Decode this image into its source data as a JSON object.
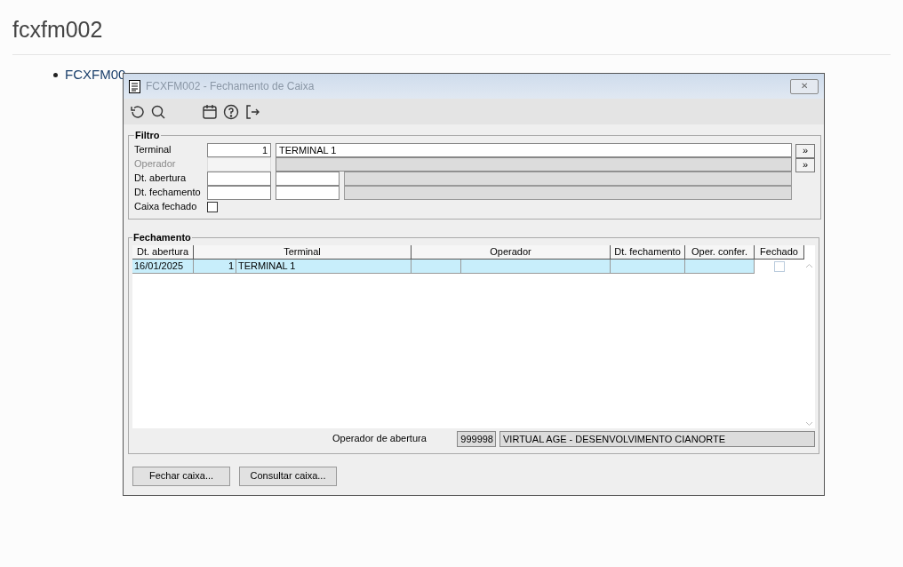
{
  "page": {
    "title": "fcxfm002",
    "list_item": "FCXFM00"
  },
  "window": {
    "title": "FCXFM002 - Fechamento de Caixa",
    "close": "✕"
  },
  "filter": {
    "legend": "Filtro",
    "rows": [
      {
        "label": "Terminal",
        "disabled": false,
        "code": "1",
        "description": "TERMINAL 1",
        "kind": "lookup",
        "button": "»"
      },
      {
        "label": "Operador",
        "disabled": true,
        "kind": "lookup",
        "button": "»"
      },
      {
        "label": "Dt. abertura",
        "disabled": false,
        "kind": "range"
      },
      {
        "label": "Dt. fechamento",
        "disabled": false,
        "kind": "range"
      },
      {
        "label": "Caixa fechado",
        "disabled": false,
        "kind": "checkbox",
        "checked": false
      }
    ]
  },
  "grid": {
    "legend": "Fechamento",
    "columns": [
      "Dt. abertura",
      "Terminal",
      "Operador",
      "Dt. fechamento",
      "Oper. confer.",
      "Fechado"
    ],
    "rows": [
      {
        "cells": [
          "16/01/2025",
          "1",
          "TERMINAL 1",
          "",
          "",
          "",
          ""
        ],
        "fechado": false,
        "selected": true
      }
    ],
    "operator_label": "Operador de abertura",
    "operator_code": "999998",
    "operator_name": "VIRTUAL AGE - DESENVOLVIMENTO CIANORTE"
  },
  "buttons": [
    "Fechar caixa...",
    "Consultar caixa..."
  ]
}
